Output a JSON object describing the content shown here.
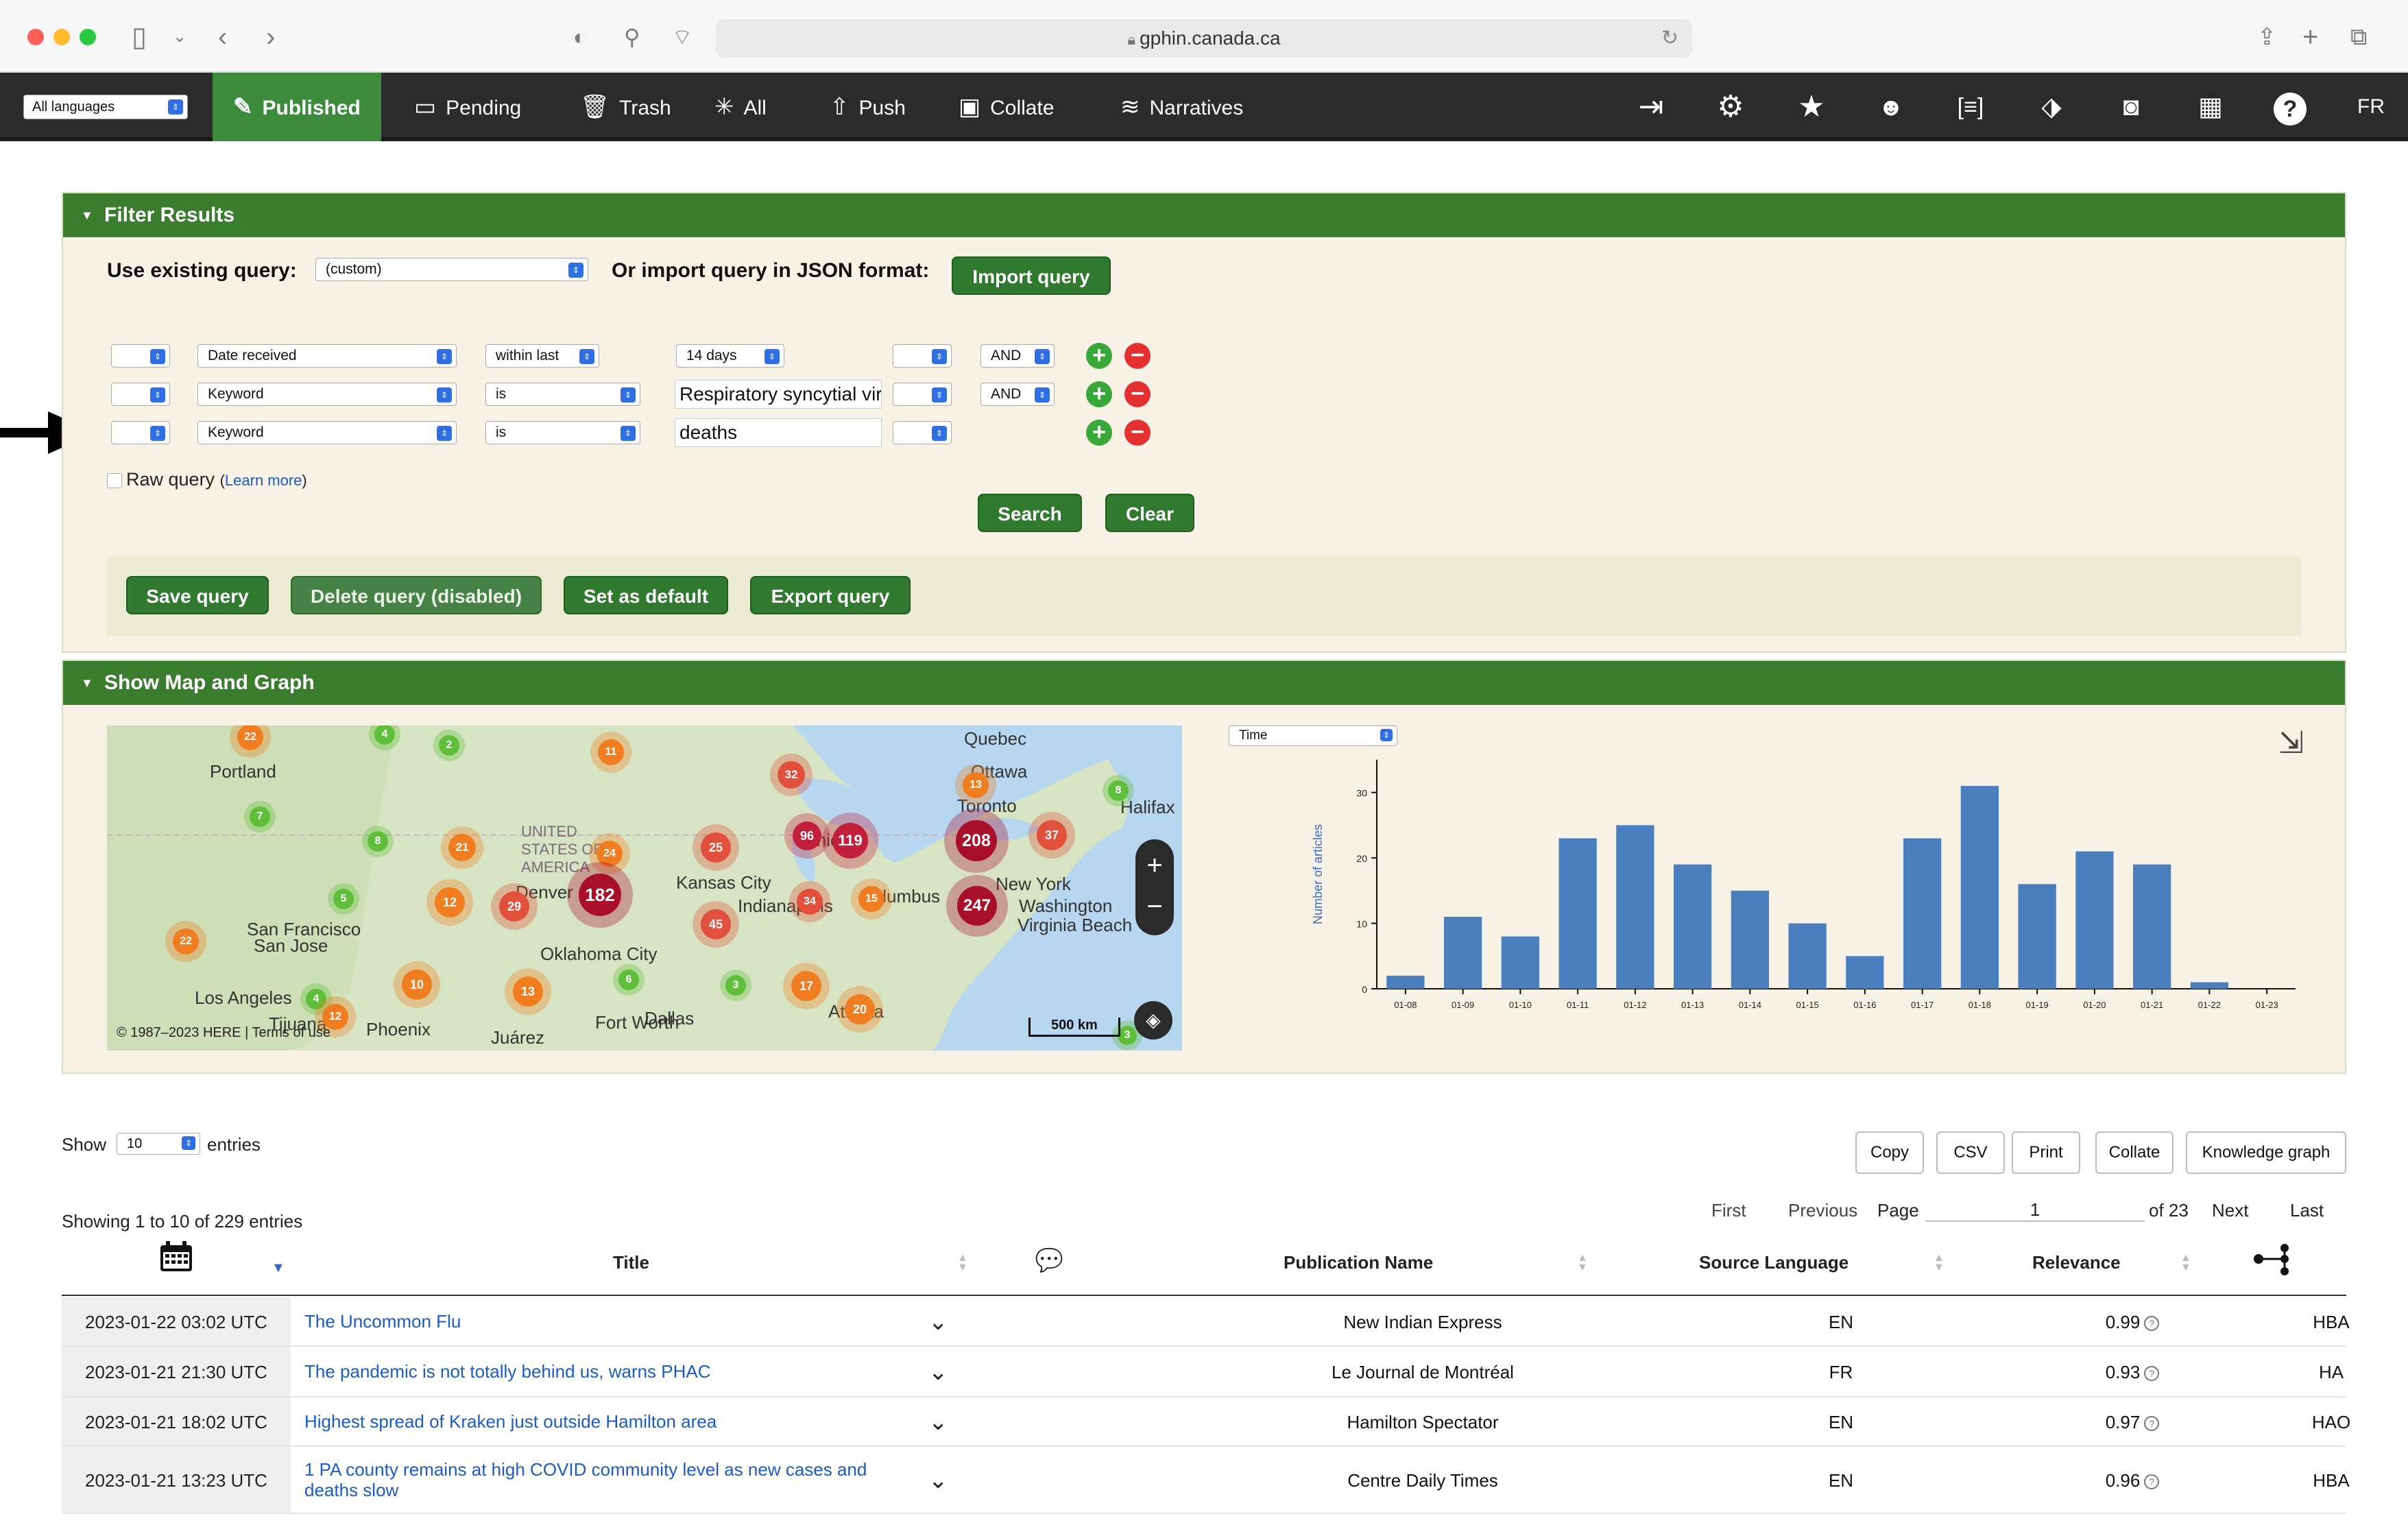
{
  "browser": {
    "url": "gphin.canada.ca"
  },
  "nav": {
    "language_select": "All languages",
    "tabs": [
      "Published",
      "Pending",
      "Trash",
      "All",
      "Push",
      "Collate",
      "Narratives"
    ],
    "lang_toggle": "FR"
  },
  "filter": {
    "header": "Filter Results",
    "use_existing_label": "Use existing query:",
    "existing_query_value": "(custom)",
    "import_label": "Or import query in JSON format:",
    "import_button": "Import query",
    "rows": [
      {
        "field": "Date received",
        "operator": "within last",
        "value": "14 days",
        "conjunction": "AND"
      },
      {
        "field": "Keyword",
        "operator": "is",
        "value": "Respiratory syncytial viru",
        "conjunction": "AND"
      },
      {
        "field": "Keyword",
        "operator": "is",
        "value": "deaths",
        "conjunction": ""
      }
    ],
    "raw_query_label": "Raw query",
    "learn_more": "Learn more",
    "search_button": "Search",
    "clear_button": "Clear",
    "save_button": "Save query",
    "delete_button": "Delete query (disabled)",
    "default_button": "Set as default",
    "export_button": "Export query"
  },
  "map_panel": {
    "header": "Show Map and Graph",
    "graph_select": "Time",
    "attribution": "© 1987–2023 HERE | Terms of use",
    "scale": "500 km",
    "zoom_in": "+",
    "zoom_out": "−",
    "labels": [
      "Portland",
      "San Francisco",
      "San Jose",
      "Los Angeles",
      "Tijuana",
      "Phoenix",
      "Juárez",
      "Denver",
      "Oklahoma City",
      "Fort Worth",
      "Dallas",
      "Kansas City",
      "Indianapolis",
      "Chicago",
      "Toronto",
      "Ottawa",
      "Quebec",
      "Halifax",
      "New York",
      "Washington",
      "Virginia Beach",
      "Atlanta",
      "UNITED STATES OF AMERICA",
      "Columbus"
    ],
    "clusters": [
      "22",
      "4",
      "2",
      "11",
      "32",
      "13",
      "8",
      "7",
      "8",
      "21",
      "24",
      "25",
      "96",
      "119",
      "208",
      "37",
      "12",
      "29",
      "182",
      "15",
      "34",
      "247",
      "45",
      "5",
      "22",
      "10",
      "4",
      "12",
      "13",
      "6",
      "3",
      "17",
      "20",
      "3"
    ]
  },
  "chart_data": {
    "type": "bar",
    "categories": [
      "01-08",
      "01-09",
      "01-10",
      "01-11",
      "01-12",
      "01-13",
      "01-14",
      "01-15",
      "01-16",
      "01-17",
      "01-18",
      "01-19",
      "01-20",
      "01-21",
      "01-22",
      "01-23"
    ],
    "values": [
      2,
      11,
      8,
      23,
      25,
      19,
      15,
      10,
      5,
      23,
      31,
      16,
      21,
      19,
      1,
      0
    ],
    "title": "",
    "xlabel": "",
    "ylabel": "Number of articles",
    "ylim": [
      0,
      35
    ],
    "yticks": [
      "0",
      "10",
      "20",
      "30"
    ],
    "grid": false,
    "color": "#4a7fbf"
  },
  "table": {
    "show_label": "Show",
    "entries_value": "10",
    "entries_label": "entries",
    "buttons": [
      "Copy",
      "CSV",
      "Print",
      "Collate",
      "Knowledge graph"
    ],
    "showing": "Showing 1 to 10 of 229 entries",
    "pager": {
      "first": "First",
      "previous": "Previous",
      "page_label": "Page",
      "page": "1",
      "of": "of 23",
      "next": "Next",
      "last": "Last"
    },
    "headers": [
      "Title",
      "Publication Name",
      "Source Language",
      "Relevance"
    ],
    "rows": [
      {
        "date": "2023-01-22 03:02 UTC",
        "title": "The Uncommon Flu",
        "publication": "New Indian Express",
        "lang": "EN",
        "relevance": "0.99",
        "tag": "HBA"
      },
      {
        "date": "2023-01-21 21:30 UTC",
        "title": "The pandemic is not totally behind us, warns PHAC",
        "publication": "Le Journal de Montréal",
        "lang": "FR",
        "relevance": "0.93",
        "tag": "HA"
      },
      {
        "date": "2023-01-21 18:02 UTC",
        "title": "Highest spread of Kraken just outside Hamilton area",
        "publication": "Hamilton Spectator",
        "lang": "EN",
        "relevance": "0.97",
        "tag": "HAO"
      },
      {
        "date": "2023-01-21 13:23 UTC",
        "title": "1 PA county remains at high COVID community level as new cases and deaths slow",
        "publication": "Centre Daily Times",
        "lang": "EN",
        "relevance": "0.96",
        "tag": "HBA"
      }
    ]
  }
}
